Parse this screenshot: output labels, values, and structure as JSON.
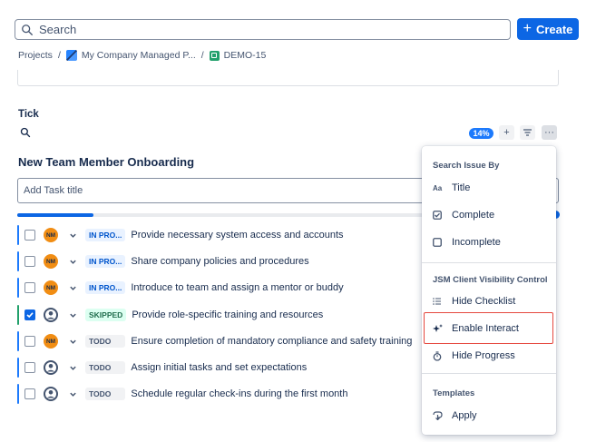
{
  "search": {
    "placeholder": "Search"
  },
  "create_button": {
    "label": "Create"
  },
  "breadcrumb": {
    "projects": "Projects",
    "project_name": "My Company Managed P...",
    "issue_key": "DEMO-15"
  },
  "tick": {
    "title": "Tick"
  },
  "toolbar": {
    "progress_badge": "14%",
    "add": "+",
    "more": "···"
  },
  "checklist": {
    "title": "New Team Member Onboarding",
    "add_placeholder": "Add Task title",
    "progress": 0.14
  },
  "tasks": [
    {
      "avatar": "NM",
      "status": "IN PRO...",
      "text": "Provide necessary system access and accounts",
      "checked": false
    },
    {
      "avatar": "NM",
      "status": "IN PRO...",
      "text": "Share company policies and procedures",
      "checked": false
    },
    {
      "avatar": "NM",
      "status": "IN PRO...",
      "text": "Introduce to team and assign a mentor or buddy",
      "checked": false
    },
    {
      "avatar": "",
      "status": "SKIPPED",
      "text": "Provide role-specific training and resources",
      "checked": true
    },
    {
      "avatar": "NM",
      "status": "TODO",
      "text": "Ensure completion of mandatory compliance and safety training",
      "checked": false
    },
    {
      "avatar": "",
      "status": "TODO",
      "text": "Assign initial tasks and set expectations",
      "checked": false
    },
    {
      "avatar": "",
      "status": "TODO",
      "text": "Schedule regular check-ins during the first month",
      "checked": false
    }
  ],
  "menu": {
    "search_heading": "Search Issue By",
    "title_item": "Title",
    "title_icon_text": "Aa",
    "complete_item": "Complete",
    "incomplete_item": "Incomplete",
    "visibility_heading": "JSM Client Visibility Control",
    "hide_checklist": "Hide Checklist",
    "enable_interact": "Enable Interact",
    "hide_progress": "Hide Progress",
    "templates_heading": "Templates",
    "apply": "Apply"
  },
  "colors": {
    "primary": "#0c66e4",
    "avatar_orange": "#f18d13",
    "skipped_green": "#216e4e",
    "highlight_red": "#e5483f"
  }
}
